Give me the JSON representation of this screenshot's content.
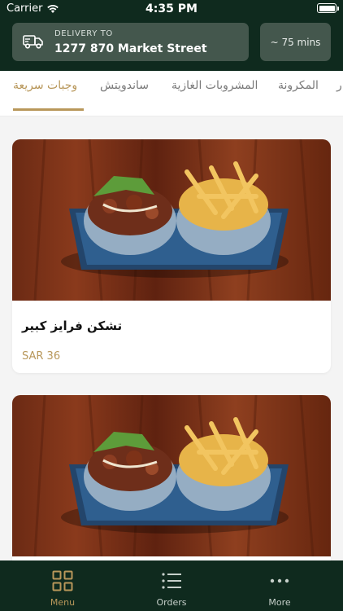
{
  "status_bar": {
    "carrier": "Carrier",
    "time": "4:35 PM"
  },
  "delivery": {
    "label": "DELIVERY TO",
    "address": "1277 870 Market Street",
    "eta": "~ 75 mins"
  },
  "categories": {
    "tabs": [
      {
        "label": "وجبات سريعة",
        "active": true
      },
      {
        "label": "ساندويتش",
        "active": false
      },
      {
        "label": "المشروبات الغازية",
        "active": false
      },
      {
        "label": "المكرونة",
        "active": false
      },
      {
        "label": "ر",
        "active": false
      }
    ],
    "accent_color": "#b8975a"
  },
  "products": [
    {
      "name": "تشكن فرايز كبير",
      "price": "SAR 36"
    },
    {
      "name": "",
      "price": ""
    }
  ],
  "bottom_nav": {
    "items": [
      {
        "label": "Menu",
        "icon": "grid-icon",
        "active": true
      },
      {
        "label": "Orders",
        "icon": "list-icon",
        "active": false
      },
      {
        "label": "More",
        "icon": "more-dots-icon",
        "active": false
      }
    ]
  },
  "colors": {
    "header_bg": "#0f2a1e",
    "box_bg": "#44574d",
    "accent": "#b8975a"
  }
}
